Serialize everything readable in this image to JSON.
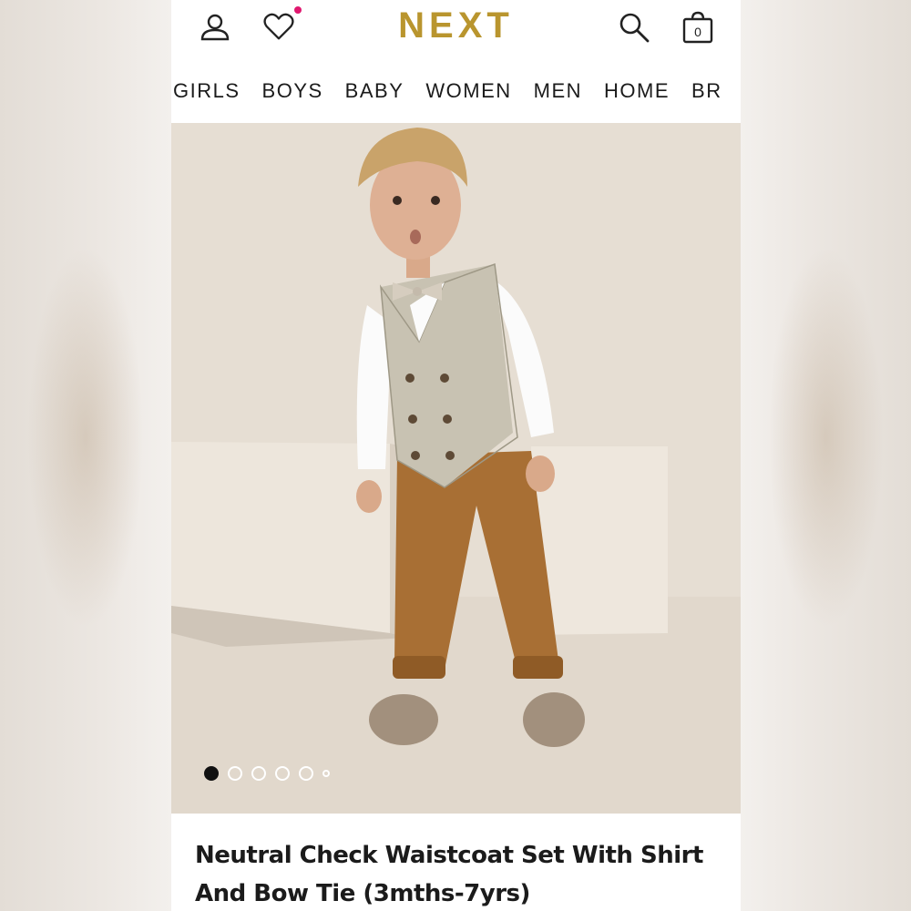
{
  "brand": {
    "logo_text": "NEXT",
    "accent_color": "#b9952e"
  },
  "header": {
    "icons": [
      "account-icon",
      "heart-icon",
      "search-icon",
      "bag-icon"
    ],
    "bag_count": "0",
    "wishlist_dot_color": "#e0186f"
  },
  "nav": {
    "items": [
      "GIRLS",
      "BOYS",
      "BABY",
      "WOMEN",
      "MEN",
      "HOME",
      "BR"
    ]
  },
  "gallery": {
    "image_count": 6,
    "active_index": 0
  },
  "product": {
    "title_line1": "Neutral Check Waistcoat Set With Shirt",
    "title_line2": "And Bow Tie (3mths-7yrs)"
  }
}
